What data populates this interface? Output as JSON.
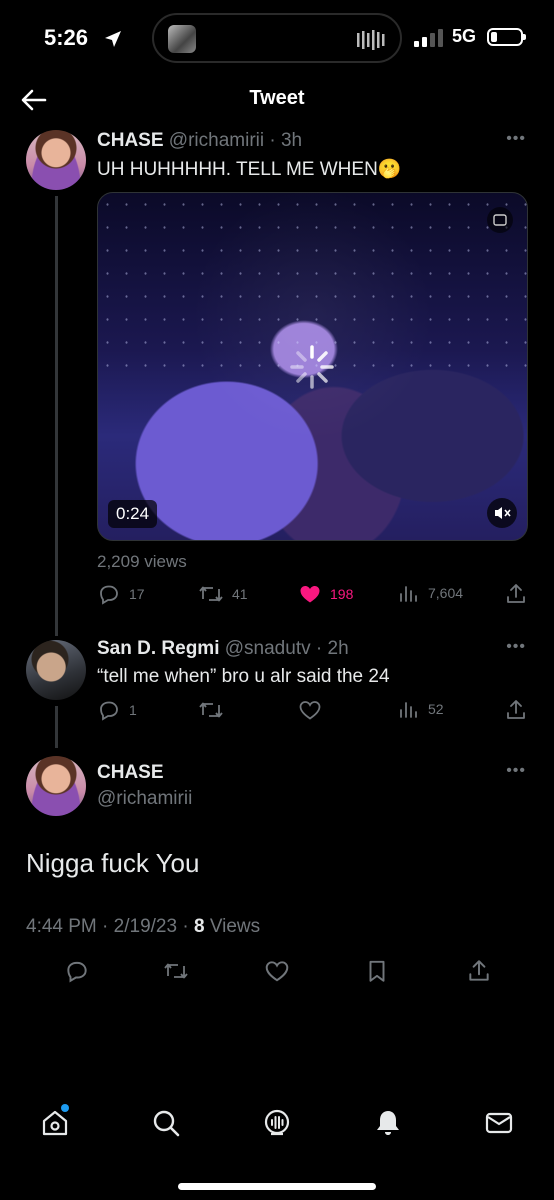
{
  "status_bar": {
    "time": "5:26",
    "network": "5G"
  },
  "header": {
    "title": "Tweet"
  },
  "tweet1": {
    "name": "CHASE",
    "handle": "@richamirii",
    "time": "3h",
    "text": "UH HUHHHHH. TELL ME WHEN🫢",
    "video_duration": "0:24",
    "views": "2,209 views",
    "replies": "17",
    "retweets": "41",
    "likes": "198",
    "view_count": "7,604"
  },
  "tweet2": {
    "name": "San D. Regmi",
    "handle": "@snadutv",
    "time": "2h",
    "text": "“tell me when” bro u alr said the 24",
    "replies": "1",
    "view_count": "52"
  },
  "main_tweet": {
    "name": "CHASE",
    "handle": "@richamirii",
    "text": "Nigga fuck You",
    "time": "4:44 PM",
    "date": "2/19/23",
    "views_count": "8",
    "views_label": "Views"
  },
  "colors": {
    "like": "#f91880",
    "accent": "#1d9bf0",
    "dim": "#71767b"
  },
  "icons": [
    "location-arrow-icon",
    "back-arrow-icon",
    "more-icon",
    "reply-icon",
    "retweet-icon",
    "like-icon",
    "views-icon",
    "share-icon",
    "bookmark-icon",
    "home-icon",
    "search-icon",
    "spaces-icon",
    "notifications-icon",
    "messages-icon"
  ]
}
